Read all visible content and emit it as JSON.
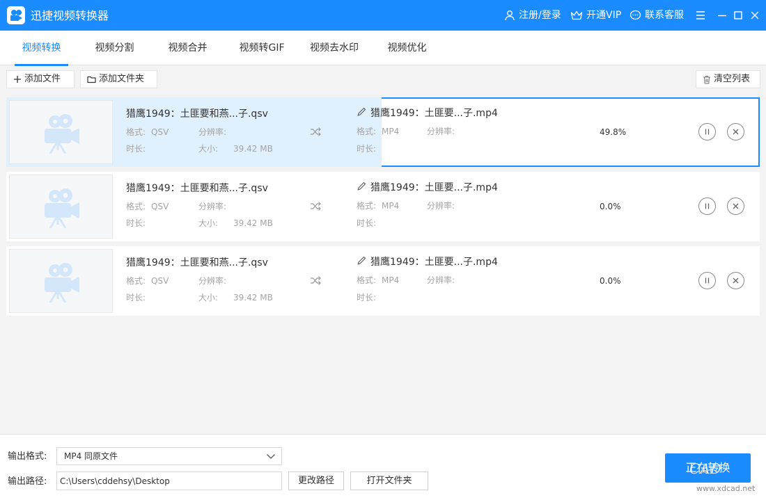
{
  "app": {
    "title": "迅捷视频转换器"
  },
  "header": {
    "login": "注册/登录",
    "vip": "开通VIP",
    "support": "联系客服"
  },
  "tabs": [
    {
      "label": "视频转换",
      "active": true
    },
    {
      "label": "视频分割",
      "active": false
    },
    {
      "label": "视频合并",
      "active": false
    },
    {
      "label": "视频转GIF",
      "active": false
    },
    {
      "label": "视频去水印",
      "active": false
    },
    {
      "label": "视频优化",
      "active": false
    }
  ],
  "toolbar": {
    "add_file": "添加文件",
    "add_folder": "添加文件夹",
    "clear_list": "清空列表"
  },
  "labels": {
    "format": "格式:",
    "resolution": "分辨率:",
    "duration": "时长:",
    "size": "大小:"
  },
  "files": [
    {
      "source_name": "猎鹰1949：土匪要和燕...子.qsv",
      "source_format": "QSV",
      "source_size": "39.42 MB",
      "target_name": "猎鹰1949：土匪要...子.mp4",
      "target_format": "MP4",
      "progress_text": "49.8%",
      "progress": 0.498,
      "selected": true
    },
    {
      "source_name": "猎鹰1949：土匪要和燕...子.qsv",
      "source_format": "QSV",
      "source_size": "39.42 MB",
      "target_name": "猎鹰1949：土匪要...子.mp4",
      "target_format": "MP4",
      "progress_text": "0.0%",
      "progress": 0,
      "selected": false
    },
    {
      "source_name": "猎鹰1949：土匪要和燕...子.qsv",
      "source_format": "QSV",
      "source_size": "39.42 MB",
      "target_name": "猎鹰1949：土匪要...子.mp4",
      "target_format": "MP4",
      "progress_text": "0.0%",
      "progress": 0,
      "selected": false
    }
  ],
  "bottom": {
    "output_format_label": "输出格式:",
    "output_format_value": "MP4  同原文件",
    "output_path_label": "输出路径:",
    "output_path_value": "C:\\Users\\cddehsy\\Desktop",
    "change_path": "更改路径",
    "open_folder": "打开文件夹",
    "convert": "正在转换"
  },
  "watermark": {
    "text": "CAD",
    "url": "www.xdcad.net"
  },
  "colors": {
    "accent": "#1a8cff",
    "progress": "#e1f0fd",
    "muted": "#a4a4a4"
  }
}
